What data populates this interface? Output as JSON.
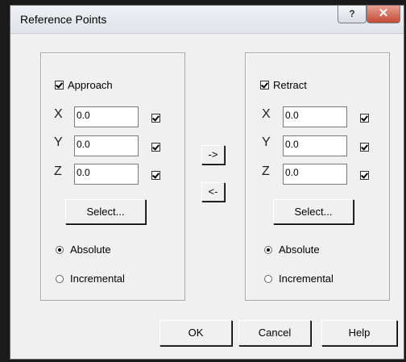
{
  "window": {
    "title": "Reference Points",
    "help_glyph": "?",
    "close_glyph": "✕"
  },
  "approach": {
    "checkbox_label": "Approach",
    "checked": true,
    "fields": [
      {
        "axis": "X",
        "value": "0.0",
        "checked": true
      },
      {
        "axis": "Y",
        "value": "0.0",
        "checked": true
      },
      {
        "axis": "Z",
        "value": "0.0",
        "checked": true
      }
    ],
    "select_label": "Select...",
    "modes": [
      {
        "label": "Absolute",
        "selected": true
      },
      {
        "label": "Incremental",
        "selected": false
      }
    ]
  },
  "retract": {
    "checkbox_label": "Retract",
    "checked": true,
    "fields": [
      {
        "axis": "X",
        "value": "0.0",
        "checked": true
      },
      {
        "axis": "Y",
        "value": "0.0",
        "checked": true
      },
      {
        "axis": "Z",
        "value": "0.0",
        "checked": true
      }
    ],
    "select_label": "Select...",
    "modes": [
      {
        "label": "Absolute",
        "selected": true
      },
      {
        "label": "Incremental",
        "selected": false
      }
    ]
  },
  "transfer": {
    "copy_right_label": "->",
    "copy_left_label": "<-"
  },
  "footer": {
    "ok_label": "OK",
    "cancel_label": "Cancel",
    "help_label": "Help"
  }
}
